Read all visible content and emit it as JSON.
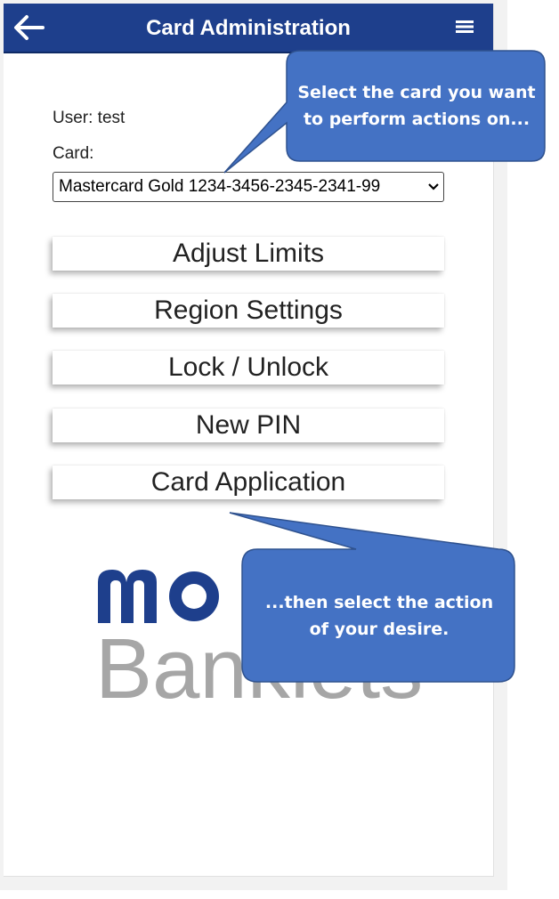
{
  "header": {
    "title": "Card Administration",
    "back_icon": "arrow-left-icon",
    "menu_icon": "hamburger-menu-icon",
    "color": "#1e3f8c"
  },
  "user": {
    "label": "User: test"
  },
  "card": {
    "label": "Card:",
    "selected": "Mastercard Gold 1234-3456-2345-2341-99"
  },
  "actions": [
    {
      "label": "Adjust Limits"
    },
    {
      "label": "Region Settings"
    },
    {
      "label": "Lock / Unlock"
    },
    {
      "label": "New PIN"
    },
    {
      "label": "Card Application"
    }
  ],
  "logo": {
    "brand_text": "Banklets",
    "brand_mark": "mo",
    "mark_color": "#1e3f8c",
    "text_color": "#a6a6a6"
  },
  "callouts": {
    "top": "Select the card you want to perform actions on...",
    "bottom": "...then select the action of your desire.",
    "color": "#4472c4"
  }
}
